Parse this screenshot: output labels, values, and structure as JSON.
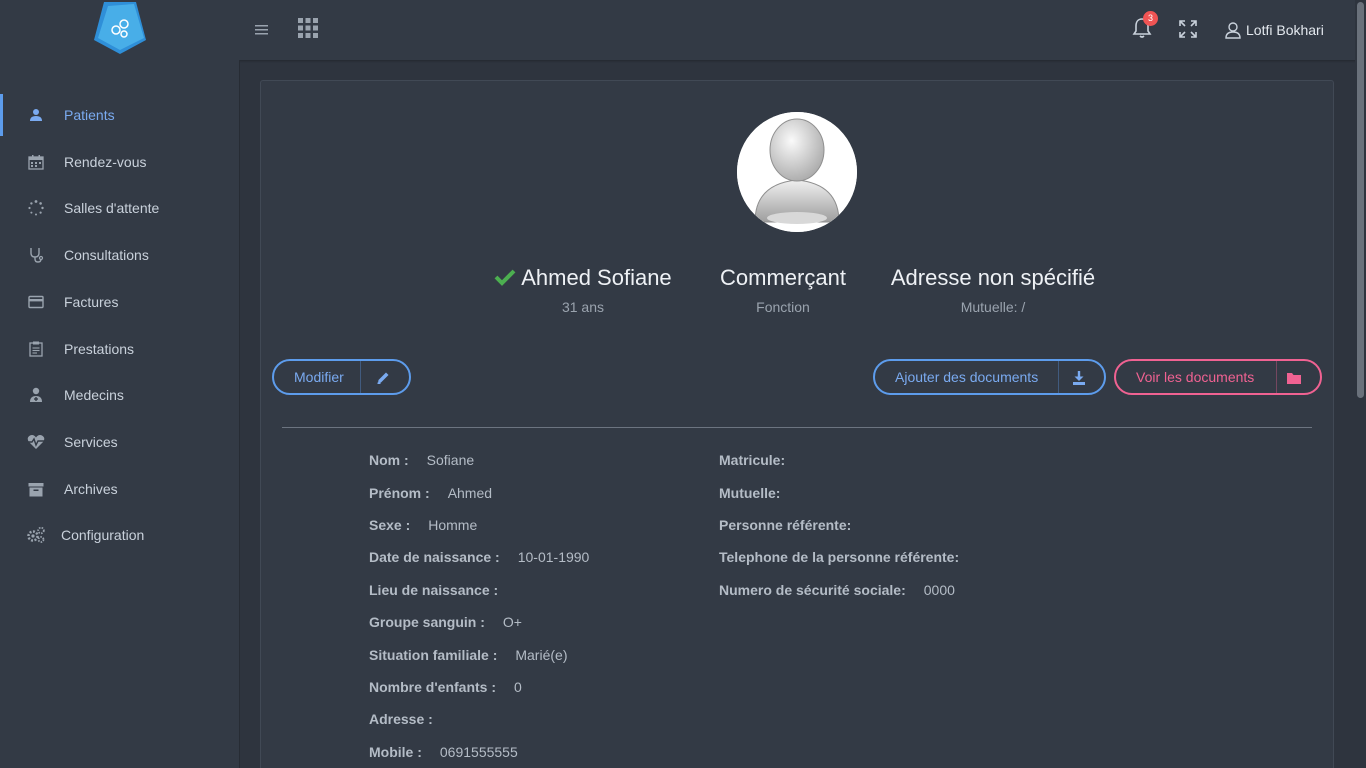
{
  "header": {
    "notification_count": "3",
    "user_name": "Lotfi Bokhari"
  },
  "sidebar": {
    "items": [
      {
        "label": "Patients",
        "icon": "user-icon",
        "active": true
      },
      {
        "label": "Rendez-vous",
        "icon": "calendar-icon"
      },
      {
        "label": "Salles d'attente",
        "icon": "spinner-icon"
      },
      {
        "label": "Consultations",
        "icon": "stethoscope-icon"
      },
      {
        "label": "Factures",
        "icon": "credit-card-icon"
      },
      {
        "label": "Prestations",
        "icon": "clipboard-icon"
      },
      {
        "label": "Medecins",
        "icon": "doctor-icon"
      },
      {
        "label": "Services",
        "icon": "heartbeat-icon"
      },
      {
        "label": "Archives",
        "icon": "archive-icon"
      },
      {
        "label": "Configuration",
        "icon": "cogs-icon"
      }
    ]
  },
  "profile": {
    "name": "Ahmed Sofiane",
    "age": "31 ans",
    "function": "Commerçant",
    "function_label": "Fonction",
    "address": "Adresse non spécifié",
    "mutuelle": "Mutuelle: /"
  },
  "actions": {
    "edit": "Modifier",
    "add_documents": "Ajouter des documents",
    "view_documents": "Voir les documents"
  },
  "details_left": [
    {
      "key": "Nom :",
      "value": "Sofiane"
    },
    {
      "key": "Prénom :",
      "value": "Ahmed"
    },
    {
      "key": "Sexe :",
      "value": "Homme"
    },
    {
      "key": "Date de naissance :",
      "value": "10-01-1990"
    },
    {
      "key": "Lieu de naissance :",
      "value": ""
    },
    {
      "key": "Groupe sanguin :",
      "value": "O+"
    },
    {
      "key": "Situation familiale :",
      "value": "Marié(e)"
    },
    {
      "key": "Nombre d'enfants :",
      "value": "0"
    },
    {
      "key": "Adresse :",
      "value": ""
    },
    {
      "key": "Mobile :",
      "value": "0691555555"
    }
  ],
  "details_right": [
    {
      "key": "Matricule:",
      "value": ""
    },
    {
      "key": "Mutuelle:",
      "value": ""
    },
    {
      "key": "Personne référente:",
      "value": ""
    },
    {
      "key": "Telephone de la personne référente:",
      "value": ""
    },
    {
      "key": "Numero de sécurité sociale:",
      "value": "0000"
    }
  ],
  "colors": {
    "accent": "#5d9cec",
    "pink": "#f06292",
    "success": "#4caf50",
    "badge": "#f05454"
  }
}
